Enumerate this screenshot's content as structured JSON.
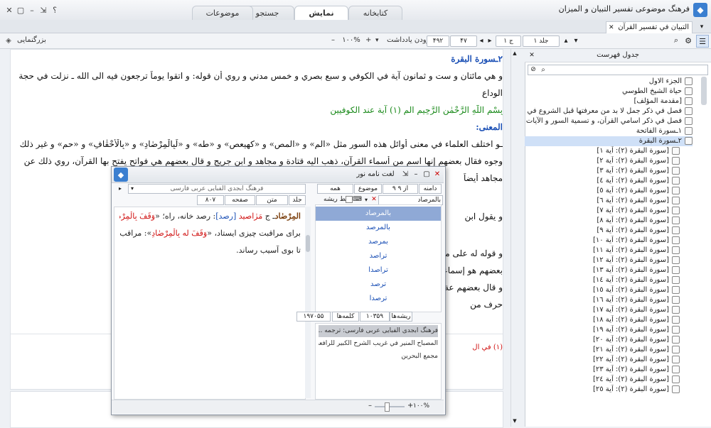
{
  "window": {
    "title": "فرهنگ موضوعی تفسیر التبیان و المیزان",
    "help": "؟"
  },
  "tabs": [
    {
      "label": "کتابخانه",
      "active": false
    },
    {
      "label": "نمایش",
      "active": true
    },
    {
      "label": "جستجو",
      "active": false
    },
    {
      "label": "موضوعات",
      "active": false
    }
  ],
  "doc_tab": {
    "label": "التبيان في تفسير القرآن"
  },
  "toolbar": {
    "volume": "جلد ۱",
    "volume_field": "ج ۱",
    "page": "۴۷",
    "page_total": "۴۹۲",
    "zoom": "۱۰۰%",
    "add_note": "افزودن یادداشت",
    "zoom_label": "بزرگنمایی"
  },
  "document": {
    "lines": [
      {
        "text": "٢ـسورة البقرة",
        "style": "heading"
      },
      {
        "text": "و هي مائتان و ست و ثمانون آية في الكوفي و سبع بصري و خمس مدني و روي أن قوله: و اتقوا يوماً ترجعون فيه الى الله ـ نزلت في حجة",
        "style": "normal"
      },
      {
        "text": "الوداع",
        "style": "normal"
      },
      {
        "text": "بِسْمِ اللّٰهِ الرَّحْمٰنِ الرَّحِيمِ الم (١) آية عند الكوفيين",
        "style": "verse"
      },
      {
        "text": "المعنى:",
        "style": "subheading"
      },
      {
        "text": "ـو اختلف العلماء في معنى أوائل هذه السور مثل «الم» و «المص» و «كهيعص» و «طه» و «لَبِالْمِرْصٰادِ» و «بِالْأَحْقٰافِ» و «حم» و غير ذلك على",
        "style": "normal"
      },
      {
        "text": "وجوه فقال بعضهم إنها اسم من أسماء القرآن، ذهب اليه قتادة و مجاهد و ابن جريج و قال بعضهم هي فواتح يفتح بها القرآن، روي ذلك عن",
        "style": "normal"
      },
      {
        "text": "مجاهد أيضاً",
        "style": "normal"
      },
      {
        "text": "و يقول ابن",
        "style": "normal"
      },
      {
        "text": "و قوله له على ما قبله و قال",
        "style": "normal"
      },
      {
        "text": "بعضهم هو إسماعيل و عن الشعبي",
        "style": "normal"
      },
      {
        "text": "و قال بعضهم عة من اسماء واقعاً كل",
        "style": "normal"
      },
      {
        "text": "حرف من",
        "style": "normal"
      }
    ],
    "footnote": "(١) في ال"
  },
  "toc": {
    "title": "جدول فهرست",
    "items": [
      {
        "label": "الجزء الاول",
        "selected": false
      },
      {
        "label": "حياة الشيخ الطوسي",
        "selected": false
      },
      {
        "label": "[مقدمة المؤلف]",
        "selected": false
      },
      {
        "label": "فصل في ذكر جمل لا بد من معرفتها قبل الشروع في تفسير القرآن",
        "selected": false
      },
      {
        "label": "فصل في ذكر اسامي القرآن، و تسمية السور و الآيات",
        "selected": false
      },
      {
        "label": "١ـسورة الفاتحة",
        "selected": false
      },
      {
        "label": "٢ـسورة البقرة",
        "selected": true
      },
      {
        "label": "[سورة البقرة (٢): آية ١]",
        "selected": false
      },
      {
        "label": "[سورة البقرة (٢): آية ٢]",
        "selected": false
      },
      {
        "label": "[سورة البقرة (٢): آية ٣]",
        "selected": false
      },
      {
        "label": "[سورة البقرة (٢): آية ٤]",
        "selected": false
      },
      {
        "label": "[سورة البقرة (٢): آية ٥]",
        "selected": false
      },
      {
        "label": "[سورة البقرة (٢): آية ٦]",
        "selected": false
      },
      {
        "label": "[سورة البقرة (٢): آية ٧]",
        "selected": false
      },
      {
        "label": "[سورة البقرة (٢): آية ٨]",
        "selected": false
      },
      {
        "label": "[سورة البقرة (٢): آية ٩]",
        "selected": false
      },
      {
        "label": "[سورة البقرة (٢): آية ١٠]",
        "selected": false
      },
      {
        "label": "[سورة البقرة (٢): آية ١١]",
        "selected": false
      },
      {
        "label": "[سورة البقرة (٢): آية ١٢]",
        "selected": false
      },
      {
        "label": "[سورة البقرة (٢): آية ١٣]",
        "selected": false
      },
      {
        "label": "[سورة البقرة (٢): آية ١٤]",
        "selected": false
      },
      {
        "label": "[سورة البقرة (٢): آية ١٥]",
        "selected": false
      },
      {
        "label": "[سورة البقرة (٢): آية ١٦]",
        "selected": false
      },
      {
        "label": "[سورة البقرة (٢): آية ١٧]",
        "selected": false
      },
      {
        "label": "[سورة البقرة (٢): آية ١٨]",
        "selected": false
      },
      {
        "label": "[سورة البقرة (٢): آية ١٩]",
        "selected": false
      },
      {
        "label": "[سورة البقرة (٢): آية ٢٠]",
        "selected": false
      },
      {
        "label": "[سورة البقرة (٢): آية ٢١]",
        "selected": false
      },
      {
        "label": "[سورة البقرة (٢): آية ٢٢]",
        "selected": false
      },
      {
        "label": "[سورة البقرة (٢): آية ٢٣]",
        "selected": false
      },
      {
        "label": "[سورة البقرة (٢): آية ٢٤]",
        "selected": false
      },
      {
        "label": "[سورة البقرة (٢): آية ٢٥]",
        "selected": false
      }
    ]
  },
  "dialog": {
    "title": "لغت نامه نور",
    "row1": {
      "field1": "دامنه",
      "field2": "۹ از ۹",
      "field3": "موضوع",
      "field4": "همه",
      "dict": "فرهنگ ابجدی الفبایی عربی  فارسی"
    },
    "row2": {
      "search_value": "بالمرصاد",
      "root_label": "فقط ریشه",
      "vol_label": "جلد",
      "text_label": "متن",
      "page_label": "صفحه",
      "page_value": "۸۰۷"
    },
    "definition": [
      {
        "parts": [
          {
            "t": "المِرْصٰاد",
            "c": "brown"
          },
          {
            "t": "ـ ج ",
            "c": "dark"
          },
          {
            "t": "مَرٰاصيد",
            "c": "red"
          },
          {
            "t": " [رصد]",
            "c": "blue"
          },
          {
            "t": ": رصد خانه، راه؛ «",
            "c": "dark"
          },
          {
            "t": "وَقَفَ بِالْمِرْصٰادِ",
            "c": "red"
          },
          {
            "t": "»:",
            "c": "dark"
          }
        ]
      },
      {
        "parts": [
          {
            "t": "برای مراقبت چیزی ایستاد، «",
            "c": "dark"
          },
          {
            "t": "وَقَفَ له",
            "c": "red"
          },
          {
            "t": " ",
            "c": "dark"
          },
          {
            "t": "بِالْمِرْصٰادِ",
            "c": "red"
          },
          {
            "t": "»: مراقب او شد",
            "c": "dark"
          }
        ]
      },
      {
        "parts": [
          {
            "t": "تا بوی آسیب رساند.",
            "c": "dark"
          }
        ]
      }
    ],
    "words": [
      "بالمرصاد",
      "بالمرصد",
      "بمرصد",
      "تراصد",
      "تراصدا",
      "ترصد",
      "ترصدا"
    ],
    "counts": {
      "roots_label": "ریشه‌ها",
      "roots_value": "۱۰۳۵۹",
      "words_label": "کلمه‌ها",
      "words_value": "۱۹۷۰۵۵"
    },
    "dicts": [
      {
        "label": "فرهنگ ابجدی الفبایی عربی  فارسی: ترجمه ...",
        "selected": true
      },
      {
        "label": "المصباح المنير في غريب الشرح الكبير للرافعي",
        "selected": false
      },
      {
        "label": "مجمع البحرين",
        "selected": false
      }
    ],
    "zoom": "۱۰۰%"
  }
}
